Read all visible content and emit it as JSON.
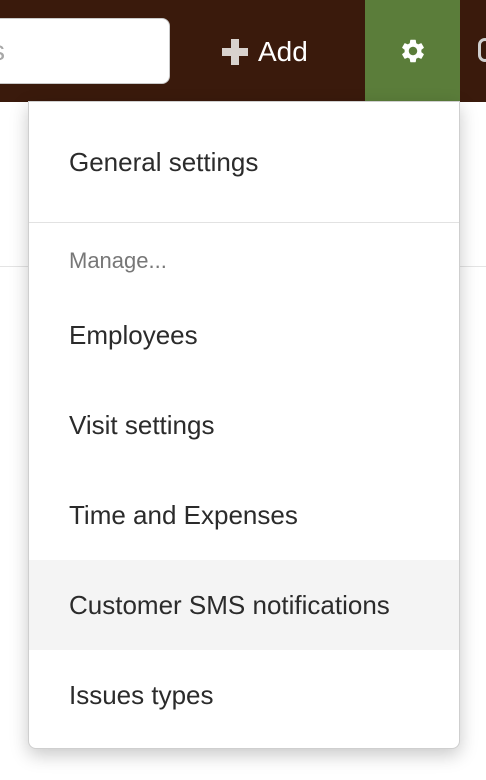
{
  "topbar": {
    "search_placeholder": "s",
    "add_label": "Add",
    "colors": {
      "background": "#3a1a0c",
      "settings_button": "#5b7d3a"
    }
  },
  "icons": {
    "add": "plus-icon",
    "settings": "gear-icon",
    "overflow": "overflow-icon"
  },
  "menu": {
    "general_settings": "General settings",
    "manage_header": "Manage...",
    "items": [
      {
        "label": "Employees"
      },
      {
        "label": "Visit settings"
      },
      {
        "label": "Time and Expenses"
      },
      {
        "label": "Customer SMS notifications",
        "highlighted": true
      },
      {
        "label": "Issues types"
      }
    ]
  }
}
